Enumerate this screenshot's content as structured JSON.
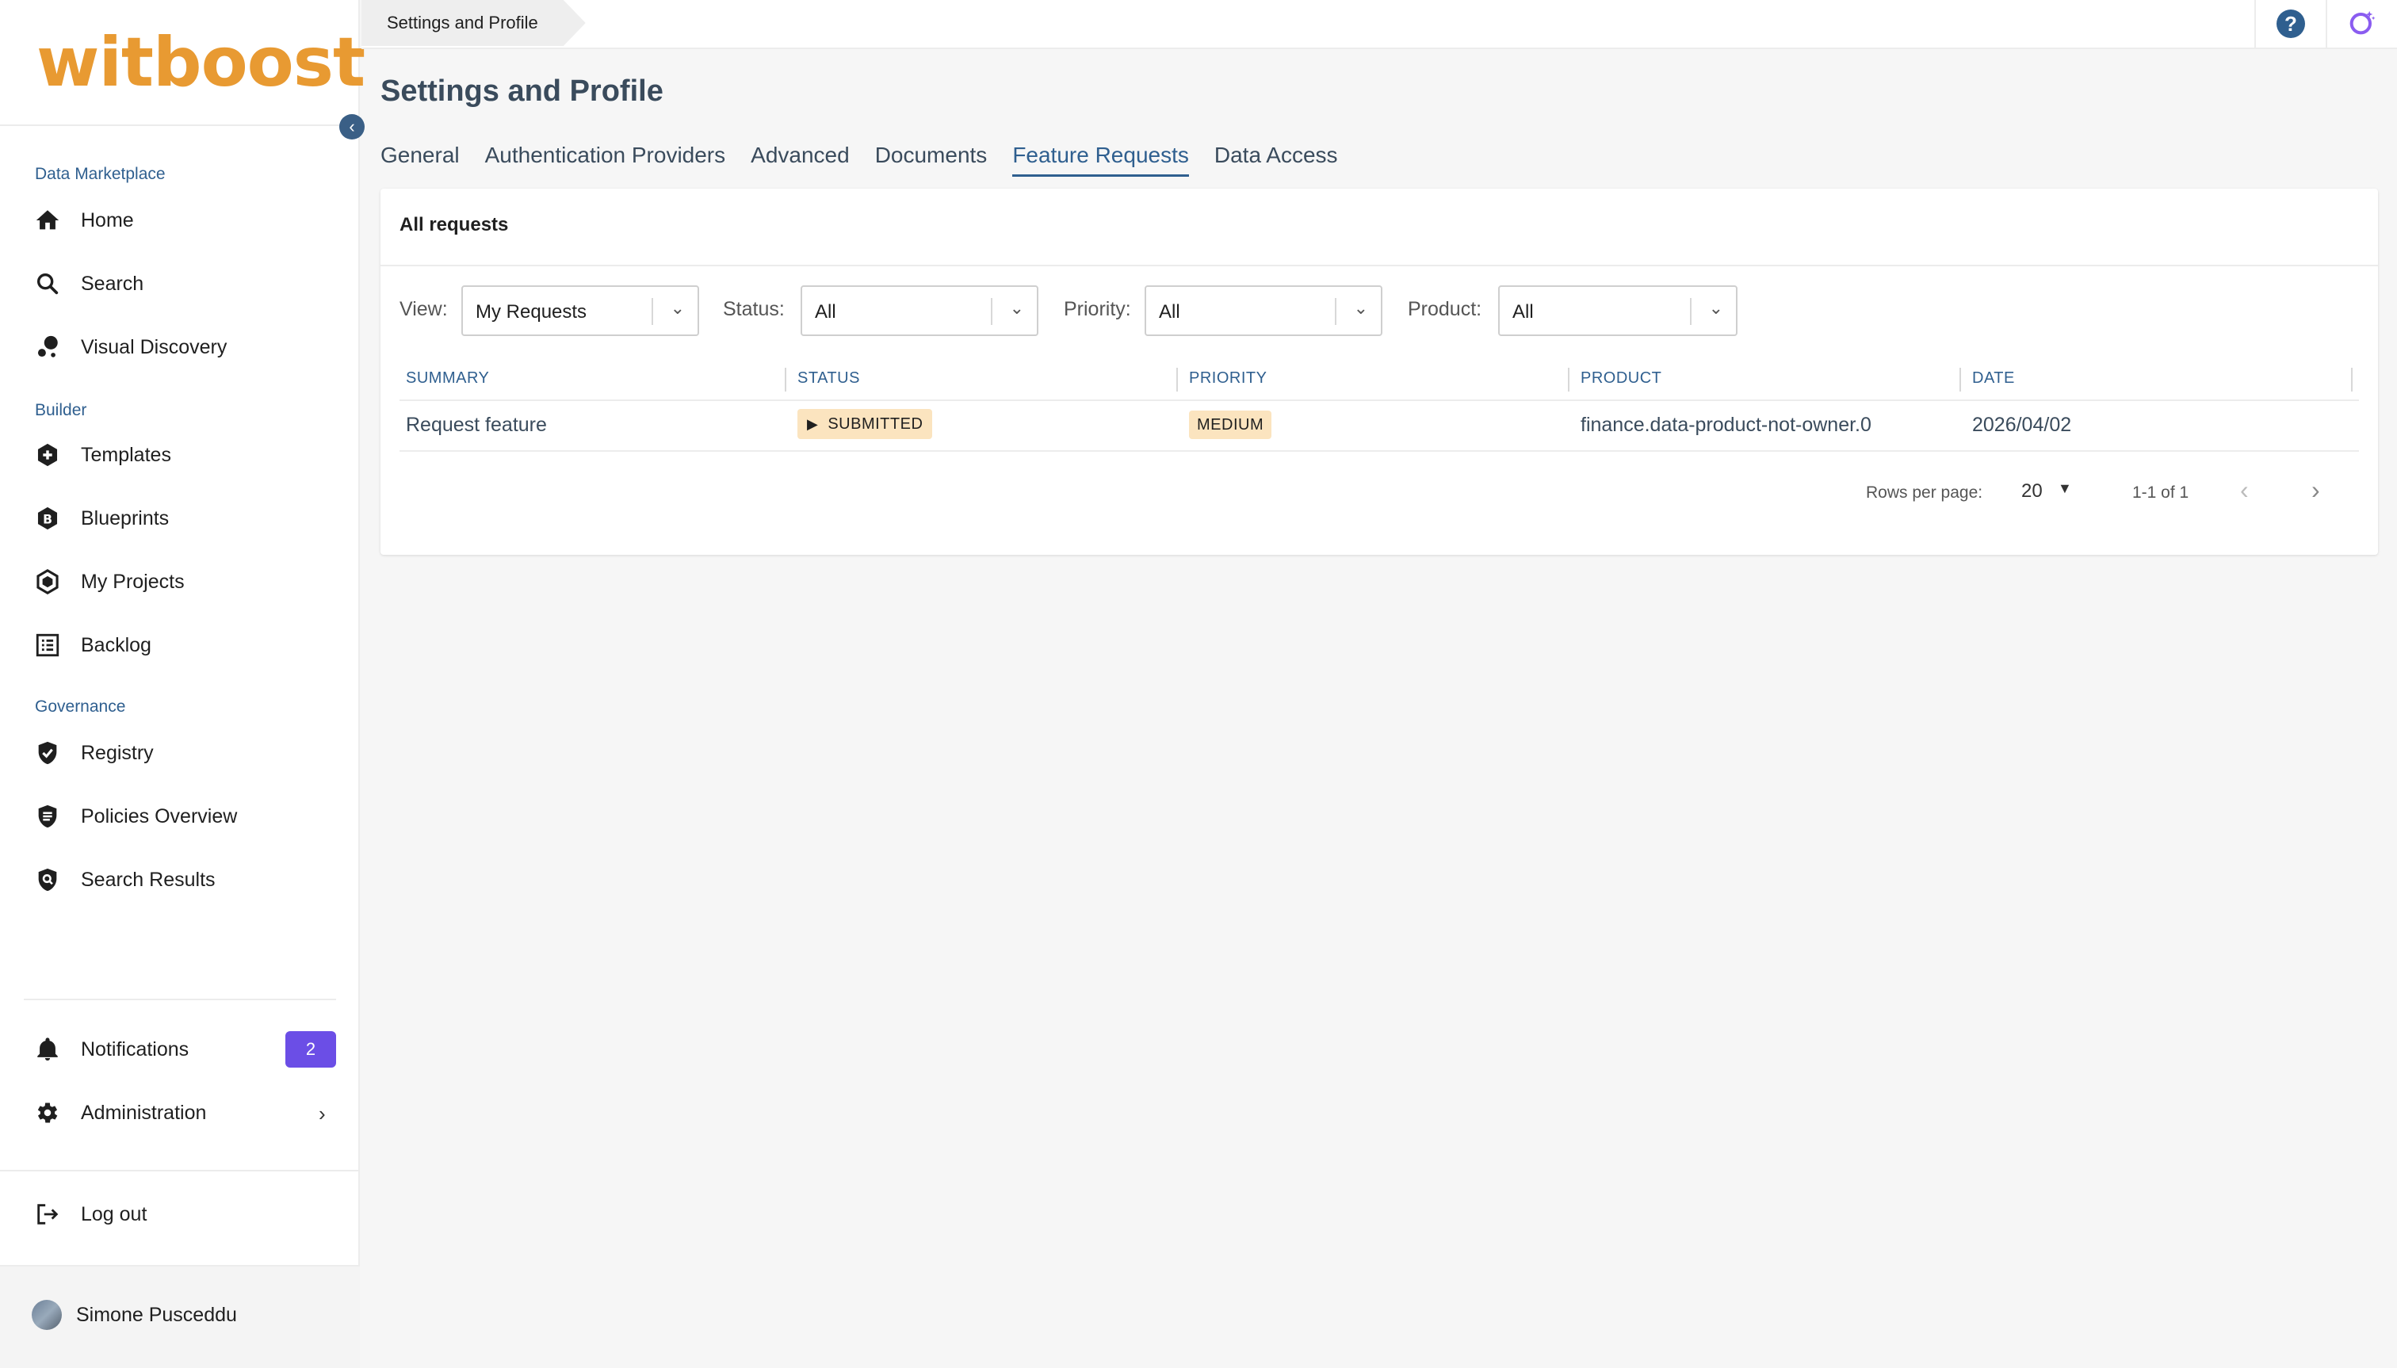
{
  "sidebar": {
    "logo": "witboost",
    "sections": [
      {
        "title": "Data Marketplace"
      },
      {
        "title": "Builder"
      },
      {
        "title": "Governance"
      }
    ],
    "items": {
      "home": "Home",
      "search": "Search",
      "visual_discovery": "Visual Discovery",
      "templates": "Templates",
      "blueprints": "Blueprints",
      "my_projects": "My Projects",
      "backlog": "Backlog",
      "registry": "Registry",
      "policies_overview": "Policies Overview",
      "search_results": "Search Results",
      "notifications": "Notifications",
      "administration": "Administration",
      "log_out": "Log out"
    },
    "notifications_count": "2",
    "user_name": "Simone Pusceddu"
  },
  "topbar": {
    "breadcrumb": "Settings and Profile",
    "help_glyph": "?"
  },
  "page": {
    "title": "Settings and Profile",
    "tabs": [
      "General",
      "Authentication Providers",
      "Advanced",
      "Documents",
      "Feature Requests",
      "Data Access"
    ],
    "active_tab": "Feature Requests"
  },
  "card": {
    "title": "All requests",
    "filters": {
      "view_label": "View:",
      "view_value": "My Requests",
      "status_label": "Status:",
      "status_value": "All",
      "priority_label": "Priority:",
      "priority_value": "All",
      "product_label": "Product:",
      "product_value": "All"
    },
    "columns": [
      "SUMMARY",
      "STATUS",
      "PRIORITY",
      "PRODUCT",
      "DATE"
    ],
    "rows": [
      {
        "summary": "Request feature",
        "status": "SUBMITTED",
        "priority": "MEDIUM",
        "product": "finance.data-product-not-owner.0",
        "date": "2026/04/02"
      }
    ],
    "pagination": {
      "rows_label": "Rows per page:",
      "rows_value": "20",
      "range": "1-1 of 1"
    }
  },
  "colors": {
    "accent": "#2f5f8f",
    "brand": "#e89a32",
    "badge": "#6b4ee6",
    "chip": "#fbe4bf"
  }
}
